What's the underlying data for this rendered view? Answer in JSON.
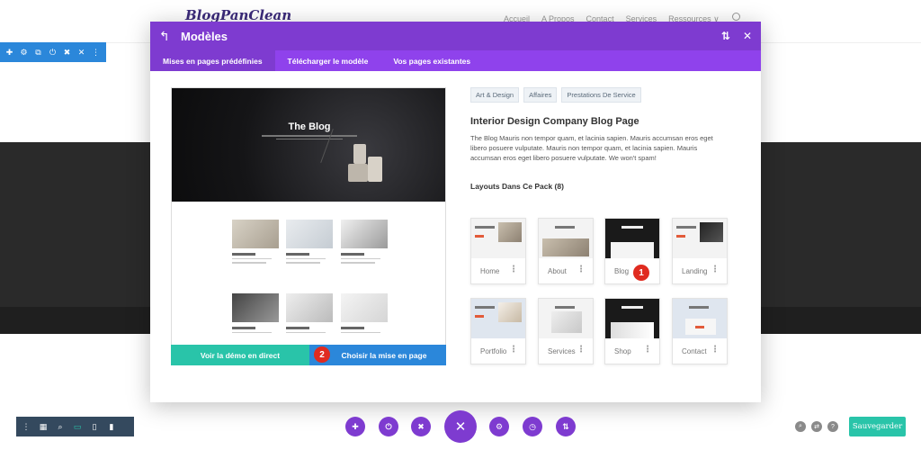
{
  "site": {
    "logo": "BlogPanClean",
    "nav": [
      "Accueil",
      "A Propos",
      "Contact",
      "Services",
      "Ressources ∨"
    ]
  },
  "row_toolbar": {
    "icons": [
      "move-icon",
      "gear-icon",
      "duplicate-icon",
      "power-icon",
      "trash-icon",
      "close-icon",
      "more-icon"
    ],
    "glyphs": [
      "✚",
      "⚙",
      "⧉",
      "⏻",
      "✖",
      "✕",
      "⋮"
    ]
  },
  "modal": {
    "title": "Modèles",
    "tabs": [
      {
        "label": "Mises en pages prédéfinies",
        "active": true
      },
      {
        "label": "Télécharger le modèle",
        "active": false
      },
      {
        "label": "Vos pages existantes",
        "active": false
      }
    ],
    "preview": {
      "hero_title": "The Blog",
      "demo_button": "Voir la démo en direct",
      "choose_button": "Choisir la mise en page",
      "choose_badge": "2"
    },
    "tags": [
      "Art & Design",
      "Affaires",
      "Prestations De Service"
    ],
    "layout_title": "Interior Design Company Blog Page",
    "layout_description": "The Blog Mauris non tempor quam, et lacinia sapien. Mauris accumsan eros eget libero posuere vulputate. Mauris non tempor quam, et lacinia sapien. Mauris accumsan eros eget libero posuere vulputate. We won't spam!",
    "pack_title": "Layouts Dans Ce Pack (8)",
    "layouts": [
      {
        "label": "Home"
      },
      {
        "label": "About"
      },
      {
        "label": "Blog",
        "badge": "1"
      },
      {
        "label": "Landing"
      },
      {
        "label": "Portfolio"
      },
      {
        "label": "Services"
      },
      {
        "label": "Shop"
      },
      {
        "label": "Contact"
      }
    ]
  },
  "bottom_bar": {
    "save_label": "Sauvegarder",
    "left_icons": [
      "menu-icon",
      "layout-icon",
      "zoom-icon",
      "desktop-icon",
      "tablet-icon",
      "phone-icon"
    ],
    "center_icons": [
      "add-icon",
      "power-icon",
      "trash-icon",
      "close-icon",
      "gear-icon",
      "history-icon",
      "sort-icon"
    ]
  },
  "colors": {
    "purple": "#7e3bd0",
    "tab_purple": "#8f42ec",
    "blue": "#2b87da",
    "teal": "#29c4a9",
    "red_badge": "#e02b20"
  }
}
